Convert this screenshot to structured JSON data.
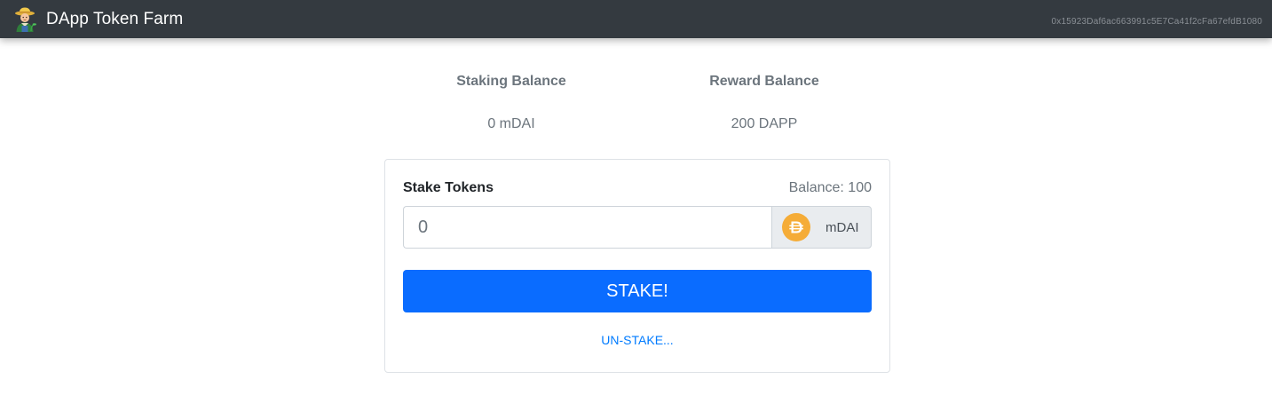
{
  "navbar": {
    "brand_title": "DApp Token Farm",
    "brand_icon": "farmer-icon",
    "account_address": "0x15923Daf6ac663991c5E7Ca41f2cFa67efdB1080"
  },
  "stats": {
    "staking_balance_label": "Staking Balance",
    "staking_balance_value": "0 mDAI",
    "reward_balance_label": "Reward Balance",
    "reward_balance_value": "200 DAPP"
  },
  "stake_form": {
    "title": "Stake Tokens",
    "balance_text": "Balance: 100",
    "amount_placeholder": "0",
    "token_icon": "dai-coin-icon",
    "token_symbol": "mDAI",
    "stake_button_label": "STAKE!",
    "unstake_link_label": "UN-STAKE..."
  },
  "colors": {
    "navbar_bg": "#343a40",
    "primary": "#0a6cff",
    "dai_yellow": "#f5ac37",
    "muted_text": "#6c757d"
  }
}
